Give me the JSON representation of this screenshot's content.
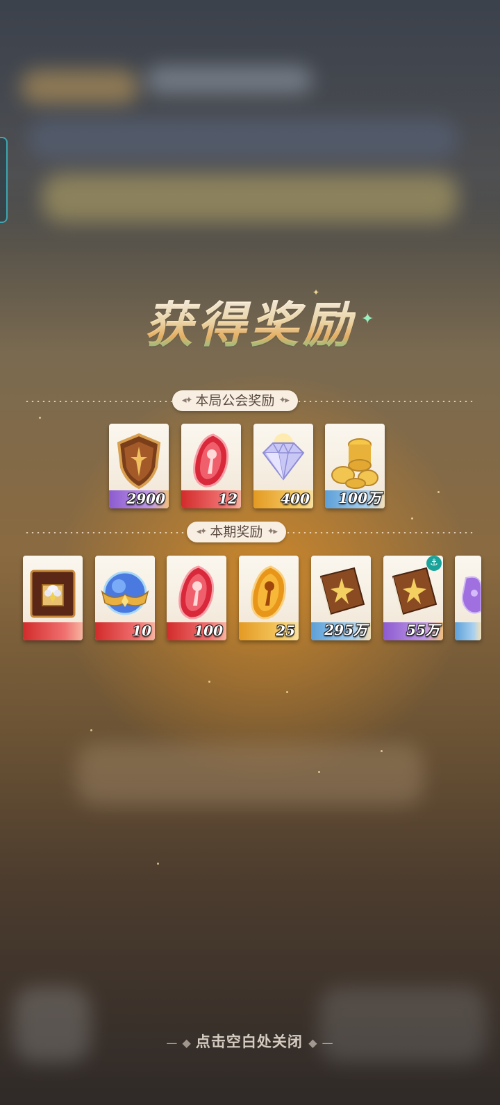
{
  "title": "获得奖励",
  "guild_section": {
    "label": "本局公会奖励",
    "items": [
      {
        "name": "guild-badge",
        "count": "2900",
        "band": "purple",
        "icon": "shield-icon"
      },
      {
        "name": "red-gem",
        "count": "12",
        "band": "red",
        "icon": "red-gem-icon"
      },
      {
        "name": "diamond",
        "count": "400",
        "band": "gold",
        "icon": "diamond-icon"
      },
      {
        "name": "gold-coins",
        "count": "100万",
        "band": "blue",
        "icon": "coins-icon"
      }
    ]
  },
  "period_section": {
    "label": "本期奖励",
    "items": [
      {
        "name": "gem-chest-card",
        "count": "",
        "band": "red",
        "icon": "gem-chest-icon"
      },
      {
        "name": "crystal-orb",
        "count": "10",
        "band": "red",
        "icon": "orb-icon"
      },
      {
        "name": "red-gem",
        "count": "100",
        "band": "red",
        "icon": "red-gem-icon"
      },
      {
        "name": "gold-gem",
        "count": "25",
        "band": "gold",
        "icon": "gold-gem-icon"
      },
      {
        "name": "exp-book-blue",
        "count": "295万",
        "band": "blue",
        "icon": "book-icon"
      },
      {
        "name": "exp-book-purple",
        "count": "55万",
        "band": "purple",
        "icon": "book-icon",
        "badge": "anchor-icon"
      },
      {
        "name": "purple-potion",
        "count": "",
        "band": "blue",
        "icon": "potion-icon"
      }
    ]
  },
  "close_hint": "点击空白处关闭"
}
